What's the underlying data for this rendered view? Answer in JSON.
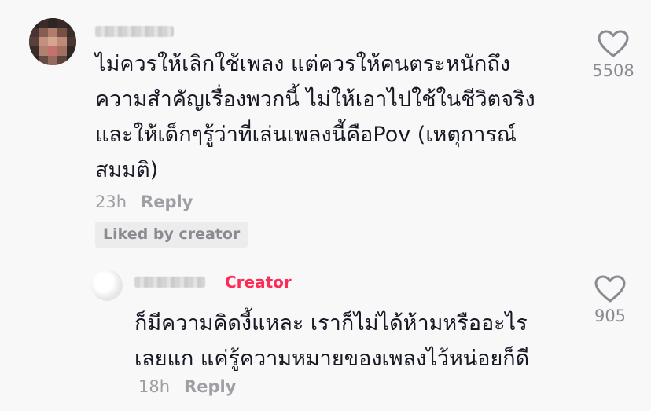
{
  "comment": {
    "text": "ไม่ควรให้เลิกใช้เพลง แต่ควรให้คนตระหนักถึง\nความสำคัญเรื่องพวกนี้ ไม่ให้เอาไปใช้ในชีวิตจริง\nและให้เด็กๆรู้ว่าที่เล่นเพลงนี้คือPov (เหตุการณ์\nสมมติ)",
    "time": "23h",
    "reply_label": "Reply",
    "liked_badge": "Liked by creator",
    "like_count": "5508"
  },
  "reply": {
    "creator_label": "Creator",
    "text": "ก็มีความคิดงี้แหละ เราก็ไม่ได้ห้ามหรืออะไร\nเลยแก แค่รู้ความหมายของเพลงไว้หน่อยก็ดี",
    "time": "18h",
    "reply_label": "Reply",
    "like_count": "905"
  },
  "icons": {
    "like": "heart-outline-icon"
  },
  "colors": {
    "accent": "#fe2c55",
    "muted": "#9e9ea5",
    "text": "#161823",
    "background": "#f8f8f8"
  }
}
